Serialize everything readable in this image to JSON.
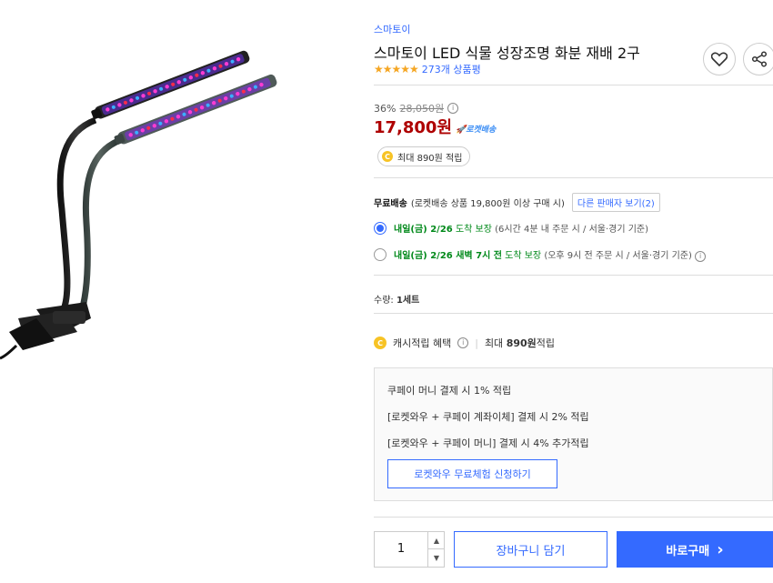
{
  "product": {
    "brand": "스마토이",
    "title": "스마토이 LED 식물 성장조명 화분 재배 2구",
    "rating_stars": "★★★★★",
    "review_count": "273개 상품평"
  },
  "price": {
    "discount_rate": "36%",
    "original_price": "28,050원",
    "sale_price": "17,800원",
    "rocket_badge": "로켓배송"
  },
  "cash": {
    "max_points": "최대 890원 적립",
    "coin_symbol": "C"
  },
  "shipping": {
    "label": "무료배송",
    "condition": "(로켓배송 상품 19,800원 이상 구매 시)",
    "other_sellers": "다른 판매자 보기(2)",
    "options": [
      {
        "day": "내일(금) 2/26",
        "suffix": "도착 보장",
        "note": "(6시간 4분 내 주문 시 / 서울·경기 기준)",
        "selected": true
      },
      {
        "day": "내일(금) 2/26 새벽 7시 전",
        "suffix": "도착 보장",
        "note": "(오후 9시 전 주문 시 / 서울·경기 기준)",
        "selected": false
      }
    ]
  },
  "quantity": {
    "label": "수량:",
    "value_text": "1세트"
  },
  "cash_benefit": {
    "label": "캐시적립 혜택",
    "separator": "|",
    "max_prefix": "최대",
    "max_amount": "890원",
    "max_suffix": "적립"
  },
  "benefits": {
    "lines": [
      "쿠페이 머니 결제 시 1% 적립",
      "[로켓와우 + 쿠페이 계좌이체] 결제 시 2% 적립",
      "[로켓와우 + 쿠페이 머니] 결제 시 4% 추가적립"
    ],
    "trial_button": "로켓와우 무료체험 신청하기"
  },
  "purchase": {
    "qty": "1",
    "up_arrow": "▲",
    "down_arrow": "▼",
    "cart_button": "장바구니 담기",
    "buy_button": "바로구매",
    "buy_arrow": "›"
  },
  "colors": {
    "accent": "#346aff",
    "price_red": "#ae0000",
    "delivery_green": "#00891a",
    "coin_yellow": "#f7c325"
  }
}
